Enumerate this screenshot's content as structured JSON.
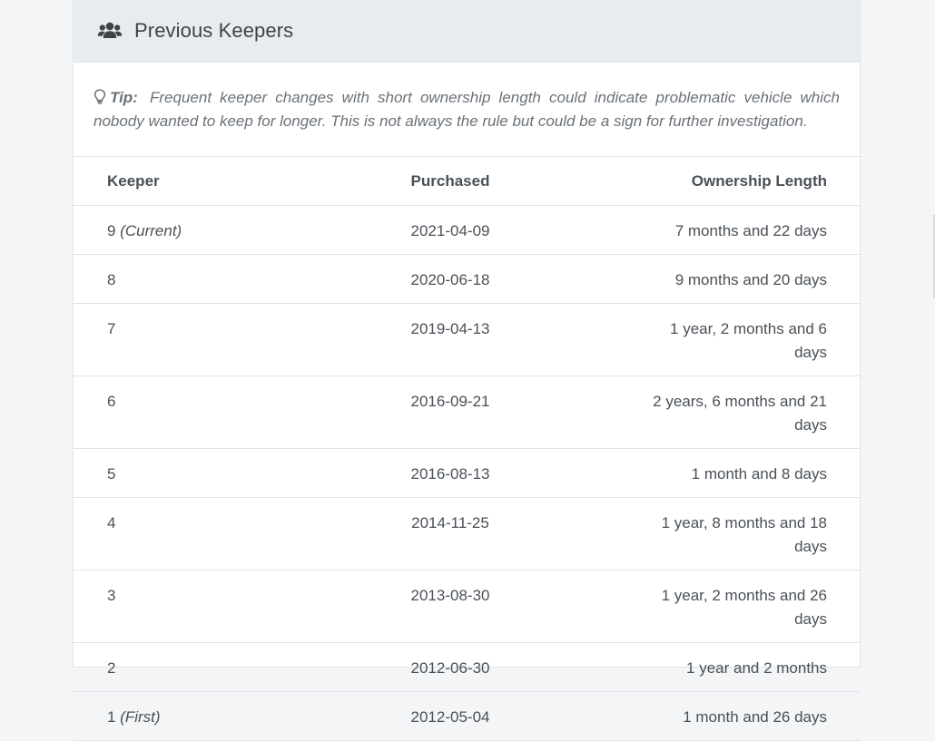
{
  "header": {
    "title": "Previous Keepers",
    "icon": "users-icon"
  },
  "tip": {
    "icon": "lightbulb-icon",
    "label": "Tip:",
    "text": "Frequent keeper changes with short ownership length could indicate problematic vehicle which nobody wanted to keep for longer. This is not always the rule but could be a sign for further investigation."
  },
  "table": {
    "columns": [
      "Keeper",
      "Purchased",
      "Ownership Length"
    ],
    "rows": [
      {
        "keeper": "9",
        "note": "(Current)",
        "purchased": "2021-04-09",
        "length": "7 months and 22 days"
      },
      {
        "keeper": "8",
        "note": "",
        "purchased": "2020-06-18",
        "length": "9 months and 20 days"
      },
      {
        "keeper": "7",
        "note": "",
        "purchased": "2019-04-13",
        "length": "1 year, 2 months and 6 days"
      },
      {
        "keeper": "6",
        "note": "",
        "purchased": "2016-09-21",
        "length": "2 years, 6 months and 21 days"
      },
      {
        "keeper": "5",
        "note": "",
        "purchased": "2016-08-13",
        "length": "1 month and 8 days"
      },
      {
        "keeper": "4",
        "note": "",
        "purchased": "2014-11-25",
        "length": "1 year, 8 months and 18 days"
      },
      {
        "keeper": "3",
        "note": "",
        "purchased": "2013-08-30",
        "length": "1 year, 2 months and 26 days"
      },
      {
        "keeper": "2",
        "note": "",
        "purchased": "2012-06-30",
        "length": "1 year and 2 months"
      },
      {
        "keeper": "1",
        "note": "(First)",
        "purchased": "2012-05-04",
        "length": "1 month and 26 days"
      }
    ]
  }
}
